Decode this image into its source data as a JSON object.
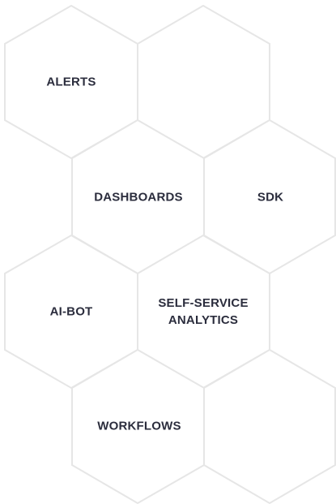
{
  "colors": {
    "stroke": "#e6e6e6",
    "text": "#2b2d3d",
    "background": "#ffffff"
  },
  "hexagons": [
    {
      "id": "alerts",
      "label": "ALERTS"
    },
    {
      "id": "empty-top",
      "label": ""
    },
    {
      "id": "dashboards",
      "label": "DASHBOARDS"
    },
    {
      "id": "sdk",
      "label": "SDK"
    },
    {
      "id": "ai-bot",
      "label": "AI-BOT"
    },
    {
      "id": "self-service-analytics",
      "label": "SELF-SERVICE\nANALYTICS"
    },
    {
      "id": "workflows",
      "label": "WORKFLOWS"
    },
    {
      "id": "empty-bottom",
      "label": ""
    }
  ]
}
